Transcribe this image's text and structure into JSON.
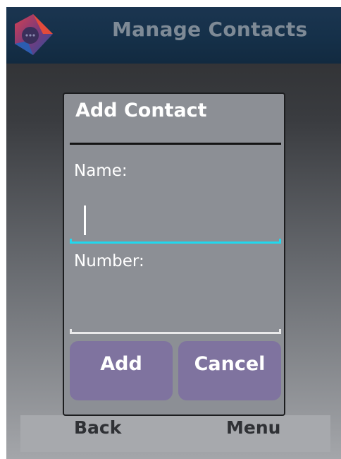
{
  "header": {
    "title": "Manage Contacts",
    "logo_icon": "app-chat-logo-icon"
  },
  "dialog": {
    "title": "Add Contact",
    "name_label": "Name:",
    "name_value": "",
    "number_label": "Number:",
    "number_value": "",
    "add_label": "Add",
    "cancel_label": "Cancel"
  },
  "softkeys": {
    "left": "Back",
    "right": "Menu"
  },
  "colors": {
    "title_bar": "#1b3550",
    "dialog_bg": "#8c8f95",
    "button_bg": "#7f739f",
    "focus_underline": "#21d8ee",
    "title_text": "#7e8a96"
  }
}
